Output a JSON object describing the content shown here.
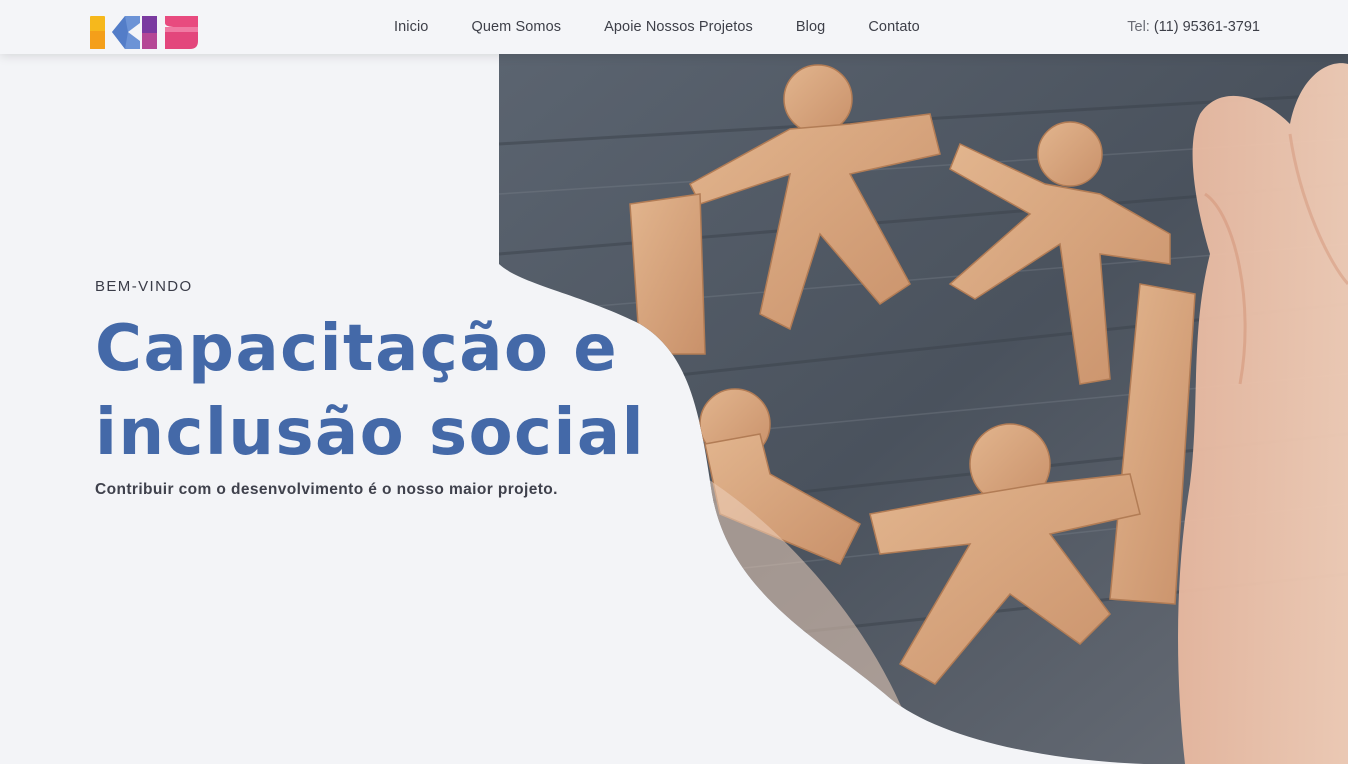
{
  "header": {
    "logo_text": "ICIS",
    "nav": [
      {
        "label": "Inicio"
      },
      {
        "label": "Quem Somos"
      },
      {
        "label": "Apoie Nossos Projetos"
      },
      {
        "label": "Blog"
      },
      {
        "label": "Contato"
      }
    ],
    "phone_label": "Tel:",
    "phone_number": "(11) 95361-3791"
  },
  "hero": {
    "eyebrow": "BEM-VINDO",
    "headline_line1": "Capacitação e",
    "headline_line2": "inclusão social",
    "subline": "Contribuir com o desenvolvimento é o nosso maior projeto."
  },
  "colors": {
    "accent_blue": "#4469a8",
    "background": "#f3f4f7",
    "logo_yellow": "#f6b81c",
    "logo_blue": "#5f8fd6",
    "logo_purple": "#7a3aa0",
    "logo_pink": "#e84b7f"
  }
}
